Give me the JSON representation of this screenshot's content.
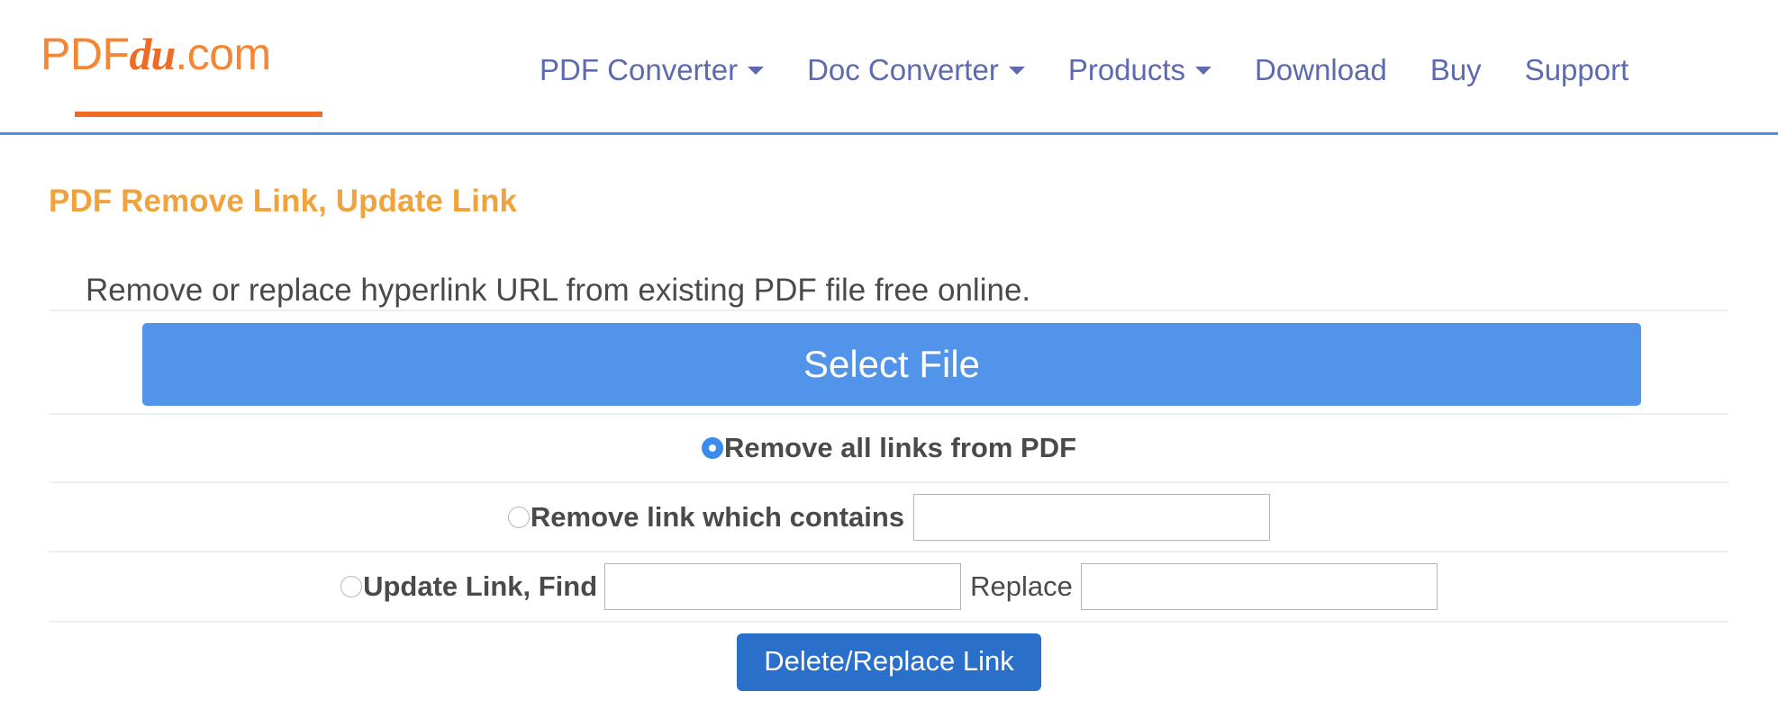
{
  "site": {
    "logo": {
      "part1": "PDF",
      "part2": "du",
      "part3": ".com",
      "color": "#f58634"
    }
  },
  "nav": {
    "items": [
      {
        "label": "PDF Converter",
        "has_caret": true
      },
      {
        "label": "Doc Converter",
        "has_caret": true
      },
      {
        "label": "Products",
        "has_caret": true
      },
      {
        "label": "Download",
        "has_caret": false
      },
      {
        "label": "Buy",
        "has_caret": false
      },
      {
        "label": "Support",
        "has_caret": false
      }
    ],
    "link_color": "#5d6ab0"
  },
  "main": {
    "title": "PDF Remove Link, Update Link",
    "title_color": "#f0a33c",
    "subtitle": "Remove or replace hyperlink URL from existing PDF file free online.",
    "select_file_label": "Select File",
    "select_file_color": "#5294ea",
    "options": [
      {
        "id": "remove-all",
        "label": "Remove all links from PDF",
        "checked": true
      },
      {
        "id": "remove-contains",
        "label": "Remove link which contains",
        "checked": false,
        "input_value": "",
        "input_placeholder": ""
      },
      {
        "id": "update-link",
        "label": "Update Link, Find",
        "checked": false,
        "find_value": "",
        "find_placeholder": "",
        "replace_label": "Replace",
        "replace_value": "",
        "replace_placeholder": ""
      }
    ],
    "submit_label": "Delete/Replace Link",
    "submit_color": "#2a6fc9"
  }
}
